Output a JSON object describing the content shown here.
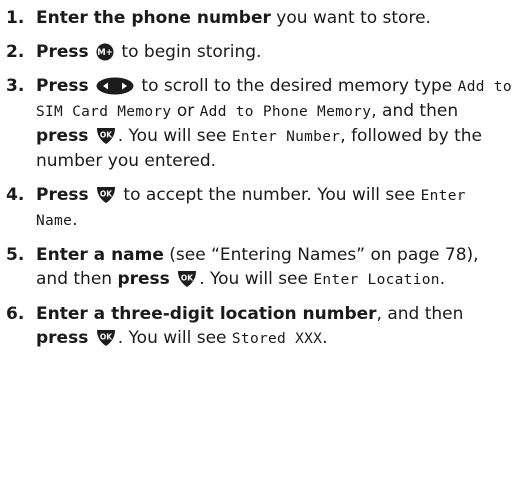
{
  "steps": [
    {
      "num": "1.",
      "bold": "Enter the phone number",
      "text": " you want to store."
    },
    {
      "num": "2.",
      "bold": "Press",
      "icon": "memory-plus-key-icon",
      "text": " to begin storing."
    },
    {
      "num": "3.",
      "bold": "Press",
      "icon": "scroll-left-right-key-icon",
      "text1": " to scroll to the desired memory type ",
      "lcd1": "Add to SIM Card Memory",
      "text2": " or ",
      "lcd2": "Add to Phone Memory",
      "text3": ", and then ",
      "bold2": "press",
      "icon2": "ok-key-icon",
      "text4": ". You will see ",
      "lcd3": "Enter Number",
      "text5": ", followed by the number you entered."
    },
    {
      "num": "4.",
      "bold": "Press",
      "icon": "ok-key-icon",
      "text1": " to accept the number. You will see ",
      "lcd1": "Enter Name",
      "text2": "."
    },
    {
      "num": "5.",
      "bold": "Enter a name",
      "text1": " (see “Entering Names” on page 78), and then ",
      "bold2": "press",
      "icon": "ok-key-icon",
      "text2": ". You will see ",
      "lcd1": "Enter Location",
      "text3": "."
    },
    {
      "num": "6.",
      "bold": "Enter a three-digit location number",
      "text1": ", and then ",
      "bold2": "press",
      "icon": "ok-key-icon",
      "text2": ". You will see ",
      "lcd1": "Stored XXX",
      "text3": "."
    }
  ],
  "keys": {
    "memory_plus_label": "M+",
    "ok_label": "OK"
  },
  "colors": {
    "key_fill": "#1c1c1c",
    "key_text": "#ffffff",
    "text": "#1a1a1a"
  }
}
